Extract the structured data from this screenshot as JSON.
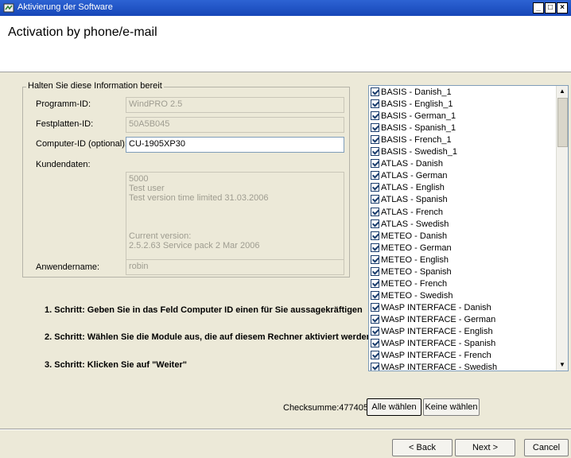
{
  "window": {
    "title": "Aktivierung der Software",
    "controls": [
      "_",
      "□",
      "×"
    ]
  },
  "header": {
    "heading": "Activation by phone/e-mail"
  },
  "group": {
    "legend": "Halten Sie diese Information bereit",
    "program_id": {
      "label": "Programm-ID:",
      "value": "WindPRO 2.5"
    },
    "disk_id": {
      "label": "Festplatten-ID:",
      "value": "50A5B045"
    },
    "computer_id": {
      "label": "Computer-ID (optional):",
      "value": "CU-1905XP30"
    },
    "customer": {
      "label": "Kundendaten:",
      "lines": [
        "5000",
        "Test user",
        "Test version time limited 31.03.2006",
        "",
        "",
        "",
        "Current version:",
        "2.5.2.63  Service pack 2 Mar 2006"
      ]
    },
    "username": {
      "label": "Anwendername:",
      "value": "robin"
    }
  },
  "steps": [
    "1. Schritt: Geben Sie in das Feld Computer ID einen für Sie aussagekräftigen",
    "2. Schritt: Wählen Sie die Module aus, die auf diesem Rechner aktiviert werden",
    "3. Schritt: Klicken Sie auf \"Weiter\""
  ],
  "modules": [
    {
      "label": "BASIS - Danish_1",
      "checked": true
    },
    {
      "label": "BASIS - English_1",
      "checked": true
    },
    {
      "label": "BASIS - German_1",
      "checked": true
    },
    {
      "label": "BASIS - Spanish_1",
      "checked": true
    },
    {
      "label": "BASIS - French_1",
      "checked": true
    },
    {
      "label": "BASIS - Swedish_1",
      "checked": true
    },
    {
      "label": "ATLAS - Danish",
      "checked": true
    },
    {
      "label": "ATLAS - German",
      "checked": true
    },
    {
      "label": "ATLAS - English",
      "checked": true
    },
    {
      "label": "ATLAS - Spanish",
      "checked": true
    },
    {
      "label": "ATLAS - French",
      "checked": true
    },
    {
      "label": "ATLAS - Swedish",
      "checked": true
    },
    {
      "label": "METEO - Danish",
      "checked": true
    },
    {
      "label": "METEO - German",
      "checked": true
    },
    {
      "label": "METEO - English",
      "checked": true
    },
    {
      "label": "METEO - Spanish",
      "checked": true
    },
    {
      "label": "METEO - French",
      "checked": true
    },
    {
      "label": "METEO - Swedish",
      "checked": true
    },
    {
      "label": "WAsP INTERFACE - Danish",
      "checked": true
    },
    {
      "label": "WAsP INTERFACE - German",
      "checked": true
    },
    {
      "label": "WAsP INTERFACE - English",
      "checked": true
    },
    {
      "label": "WAsP INTERFACE - Spanish",
      "checked": true
    },
    {
      "label": "WAsP INTERFACE - French",
      "checked": true
    },
    {
      "label": "WAsP INTERFACE - Swedish",
      "checked": true
    }
  ],
  "checksum": "Checksumme:477405",
  "buttons": {
    "select_all": "Alle wählen",
    "select_none": "Keine wählen",
    "back": "< Back",
    "next": "Next >",
    "cancel": "Cancel"
  }
}
